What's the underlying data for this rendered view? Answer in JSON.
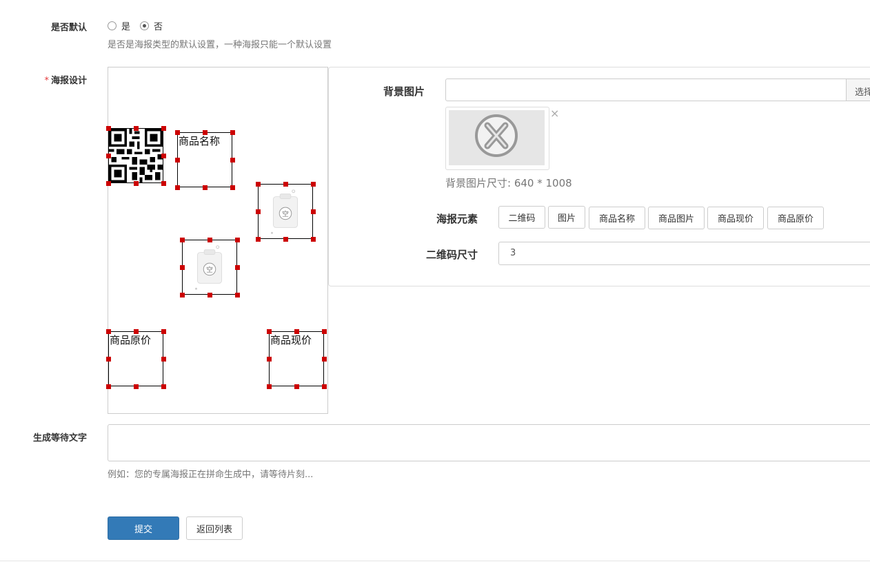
{
  "default_field": {
    "label": "是否默认",
    "options": [
      {
        "label": "是",
        "selected": false
      },
      {
        "label": "否",
        "selected": true
      }
    ],
    "help": "是否是海报类型的默认设置，一种海报只能一个默认设置"
  },
  "design_field": {
    "required_mark": "*",
    "label": "海报设计",
    "canvas_elements": {
      "qrcode": "qrcode-icon",
      "goods_name": "商品名称",
      "goods_image_1": "empty-image-icon",
      "goods_image_2": "empty-image-icon",
      "original_price": "商品原价",
      "current_price": "商品现价"
    }
  },
  "panel": {
    "background_label": "背景图片",
    "background_value": "",
    "choose_button": "选择",
    "remove_icon": "×",
    "background_size_text": "背景图片尺寸: 640 * 1008",
    "elements_label": "海报元素",
    "element_buttons": [
      "二维码",
      "图片",
      "商品名称",
      "商品图片",
      "商品现价",
      "商品原价"
    ],
    "qrcode_size_label": "二维码尺寸",
    "qrcode_size_value": "3"
  },
  "wait_text_field": {
    "label": "生成等待文字",
    "value": "",
    "help": "例如：您的专属海报正在拼命生成中，请等待片刻..."
  },
  "actions": {
    "submit": "提交",
    "back": "返回列表"
  },
  "colors": {
    "primary": "#337ab7",
    "handle": "#cc0000",
    "required": "#e4393c"
  }
}
